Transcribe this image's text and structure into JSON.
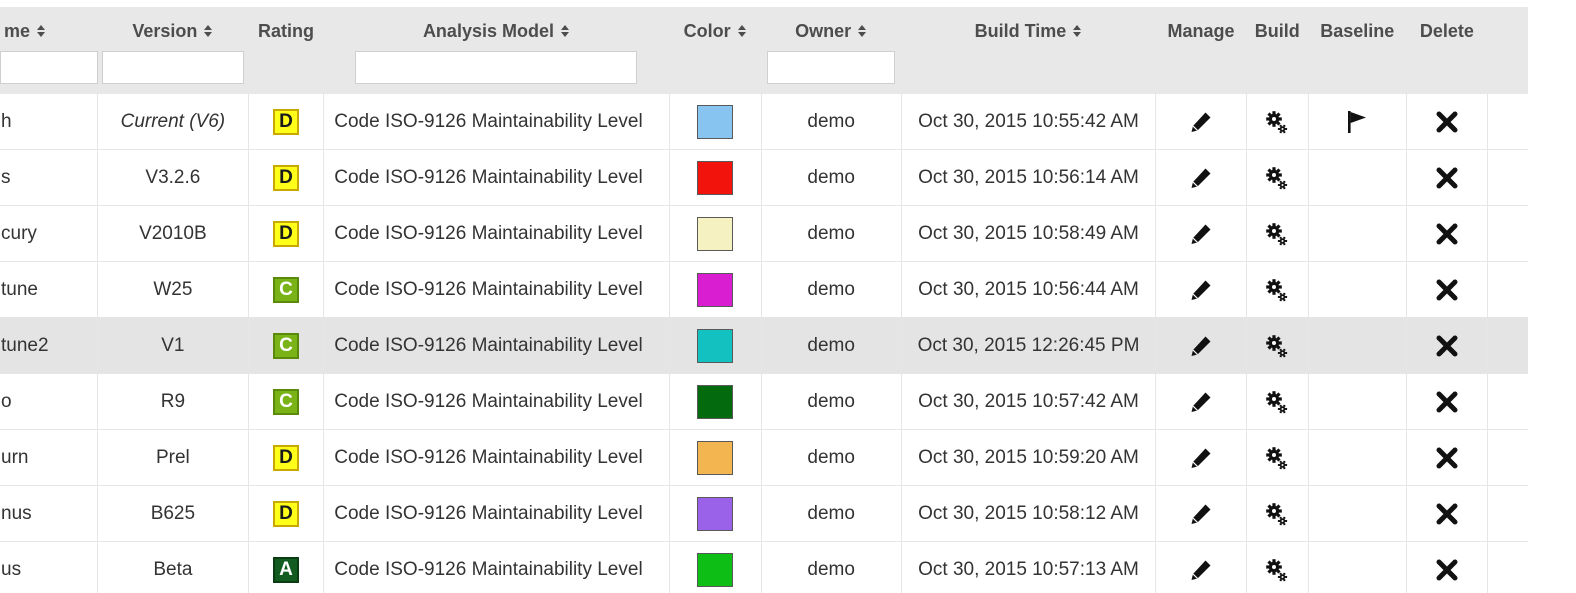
{
  "headers": {
    "name": "me",
    "version": "Version",
    "rating": "Rating",
    "analysis_model": "Analysis Model",
    "color": "Color",
    "owner": "Owner",
    "build_time": "Build Time",
    "manage": "Manage",
    "build": "Build",
    "baseline": "Baseline",
    "delete": "Delete"
  },
  "filters": {
    "name": "",
    "version": "",
    "analysis_model": "",
    "owner": ""
  },
  "rating_colors": {
    "D": {
      "bg": "#ffff1a",
      "border": "#c9a800",
      "text": "#1a1a1a"
    },
    "C": {
      "bg": "#7ab317",
      "border": "#5a8a0a",
      "text": "#ffffff"
    },
    "A": {
      "bg": "#125c21",
      "border": "#0b3d15",
      "text": "#ffffff"
    }
  },
  "icons": {
    "manage": "pencil-icon",
    "build": "gears-icon",
    "baseline": "flag-icon",
    "delete": "close-icon"
  },
  "rows": [
    {
      "name": "h",
      "version": "Current (V6)",
      "version_italic": true,
      "rating": "D",
      "analysis_model": "Code ISO-9126 Maintainability Level",
      "color": "#87c5f0",
      "owner": "demo",
      "build_time": "Oct 30, 2015 10:55:42 AM",
      "baseline": true
    },
    {
      "name": "s",
      "version": "V3.2.6",
      "rating": "D",
      "analysis_model": "Code ISO-9126 Maintainability Level",
      "color": "#f2140c",
      "owner": "demo",
      "build_time": "Oct 30, 2015 10:56:14 AM",
      "baseline": false
    },
    {
      "name": "cury",
      "version": "V2010B",
      "rating": "D",
      "analysis_model": "Code ISO-9126 Maintainability Level",
      "color": "#f5f1c0",
      "owner": "demo",
      "build_time": "Oct 30, 2015 10:58:49 AM",
      "baseline": false
    },
    {
      "name": "tune",
      "version": "W25",
      "rating": "C",
      "analysis_model": "Code ISO-9126 Maintainability Level",
      "color": "#d91ed1",
      "owner": "demo",
      "build_time": "Oct 30, 2015 10:56:44 AM",
      "baseline": false
    },
    {
      "name": "tune2",
      "version": "V1",
      "rating": "C",
      "analysis_model": "Code ISO-9126 Maintainability Level",
      "color": "#14c1c1",
      "owner": "demo",
      "build_time": "Oct 30, 2015 12:26:45 PM",
      "baseline": false,
      "highlight": true
    },
    {
      "name": "o",
      "version": "R9",
      "rating": "C",
      "analysis_model": "Code ISO-9126 Maintainability Level",
      "color": "#036b0d",
      "owner": "demo",
      "build_time": "Oct 30, 2015 10:57:42 AM",
      "baseline": false
    },
    {
      "name": "urn",
      "version": "Prel",
      "rating": "D",
      "analysis_model": "Code ISO-9126 Maintainability Level",
      "color": "#f2b54f",
      "owner": "demo",
      "build_time": "Oct 30, 2015 10:59:20 AM",
      "baseline": false
    },
    {
      "name": "nus",
      "version": "B625",
      "rating": "D",
      "analysis_model": "Code ISO-9126 Maintainability Level",
      "color": "#9a62e8",
      "owner": "demo",
      "build_time": "Oct 30, 2015 10:58:12 AM",
      "baseline": false
    },
    {
      "name": "us",
      "version": "Beta",
      "rating": "A",
      "analysis_model": "Code ISO-9126 Maintainability Level",
      "color": "#0dbf14",
      "owner": "demo",
      "build_time": "Oct 30, 2015 10:57:13 AM",
      "baseline": false
    }
  ]
}
